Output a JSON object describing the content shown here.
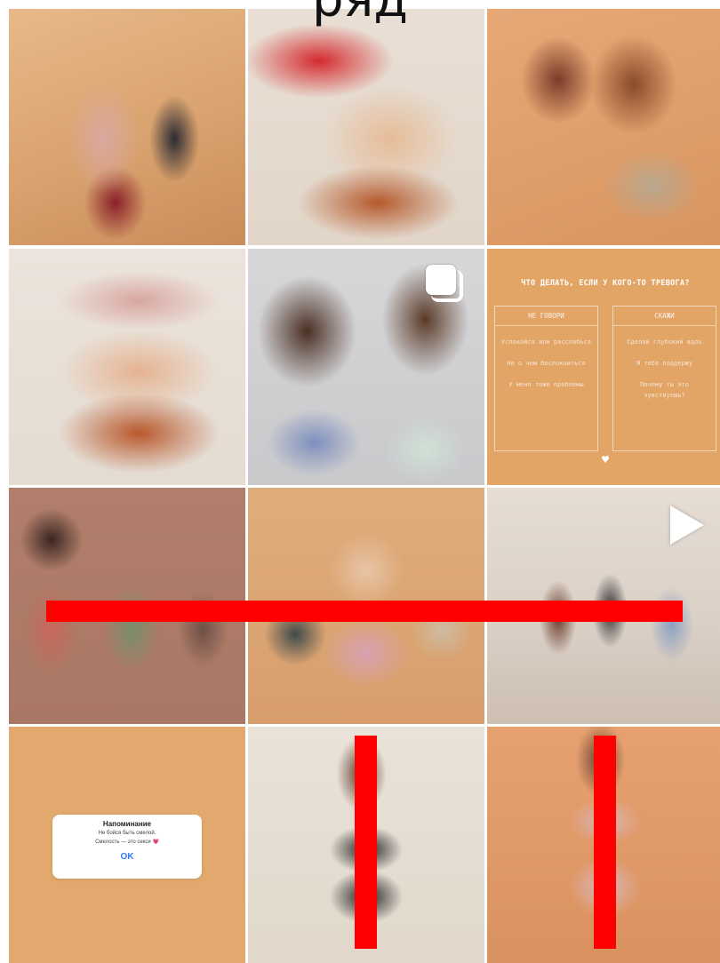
{
  "heading": {
    "text": "ряд"
  },
  "tiles": [
    {
      "name": "photo-group-six-women",
      "type": "photo"
    },
    {
      "name": "photo-red-top",
      "type": "photo"
    },
    {
      "name": "photo-two-women-hugging",
      "type": "photo"
    },
    {
      "name": "photo-torso-pink-top",
      "type": "photo"
    },
    {
      "name": "photo-two-women-curly",
      "type": "carousel",
      "icon": "carousel-icon"
    },
    {
      "name": "text-slide-anxiety",
      "type": "text"
    },
    {
      "name": "photo-three-women-seated",
      "type": "photo"
    },
    {
      "name": "photo-three-women-faces",
      "type": "photo"
    },
    {
      "name": "video-three-women-sitting",
      "type": "video",
      "icon": "play-icon"
    },
    {
      "name": "reminder-slide",
      "type": "text"
    },
    {
      "name": "photo-woman-black-set",
      "type": "photo"
    },
    {
      "name": "photo-woman-pink-set",
      "type": "photo"
    }
  ],
  "text_slide": {
    "title": "ЧТО ДЕЛАТЬ, ЕСЛИ У КОГО-ТО ТРЕВОГА?",
    "left_header": "НЕ ГОВОРИ",
    "right_header": "СКАЖИ",
    "left_items": [
      "Успокойся или расслабься",
      "Не о чем беспокоиться",
      "У меня тоже проблемы"
    ],
    "right_items": [
      "Сделай глубокий вдох",
      "Я тебя поддержу",
      "Почему ты это чувствуешь?"
    ],
    "logo": "♥"
  },
  "reminder": {
    "title": "Напоминание",
    "line1": "Не бойся быть смелой.",
    "line2": "Смелость — это секси 💗",
    "ok": "OK"
  },
  "colors": {
    "annotation": "#ff0000",
    "background": "#ffffff",
    "text_slide_bg": "#e2a566",
    "link_blue": "#3478f6"
  }
}
